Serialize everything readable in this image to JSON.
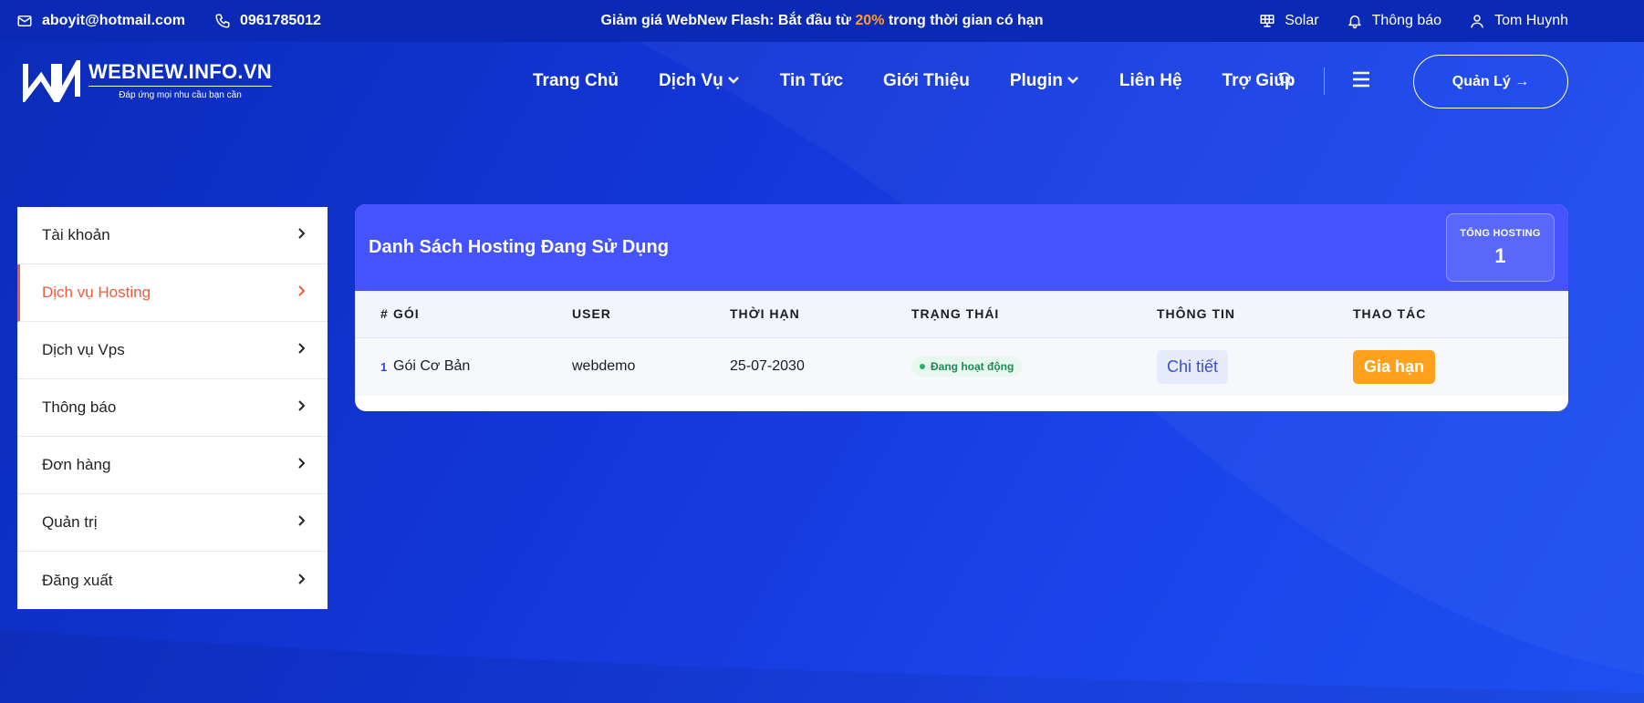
{
  "topbar": {
    "email": "aboyit@hotmail.com",
    "phone": "0961785012",
    "promo_before": "Giảm giá WebNew Flash: Bắt đầu từ",
    "promo_highlight": "20%",
    "promo_after": "trong thời gian có hạn",
    "theme_label": "Solar",
    "notifications_label": "Thông báo",
    "user_name": "Tom Huynh"
  },
  "logo": {
    "title": "WEBNEW.INFO.VN",
    "tagline": "Đáp ứng mọi nhu cầu bạn cần"
  },
  "nav": {
    "items": [
      {
        "label": "Trang Chủ",
        "dropdown": false
      },
      {
        "label": "Dịch Vụ",
        "dropdown": true
      },
      {
        "label": "Tin Tức",
        "dropdown": false
      },
      {
        "label": "Giới Thiệu",
        "dropdown": false
      },
      {
        "label": "Plugin",
        "dropdown": true
      },
      {
        "label": "Liên Hệ",
        "dropdown": false
      },
      {
        "label": "Trợ Giúp",
        "dropdown": false
      }
    ],
    "manage_button": "Quản Lý →"
  },
  "sidebar": {
    "items": [
      {
        "label": "Tài khoản",
        "active": false
      },
      {
        "label": "Dịch vụ Hosting",
        "active": true
      },
      {
        "label": "Dịch vụ Vps",
        "active": false
      },
      {
        "label": "Thông báo",
        "active": false
      },
      {
        "label": "Đơn hàng",
        "active": false
      },
      {
        "label": "Quản trị",
        "active": false
      },
      {
        "label": "Đăng xuất",
        "active": false
      }
    ]
  },
  "card": {
    "title": "Danh Sách Hosting Đang Sử Dụng",
    "total_label": "TỔNG HOSTING",
    "total_value": "1",
    "columns": [
      "#",
      "GÓI",
      "USER",
      "THỜI HẠN",
      "TRẠNG THÁI",
      "THÔNG TIN",
      "THAO TÁC"
    ],
    "rows": [
      {
        "num": "1",
        "package": "Gói Cơ Bản",
        "user": "webdemo",
        "expiry": "25-07-2030",
        "status": "Đang hoạt động",
        "detail_button": "Chi tiết",
        "action_button": "Gia hạn"
      }
    ]
  },
  "colors": {
    "accent": "#4453fb",
    "active_sidebar": "#f15a3c",
    "promo_highlight": "#ff9a2e",
    "renew_button": "#ffa11c",
    "status_green": "#20b56a"
  }
}
